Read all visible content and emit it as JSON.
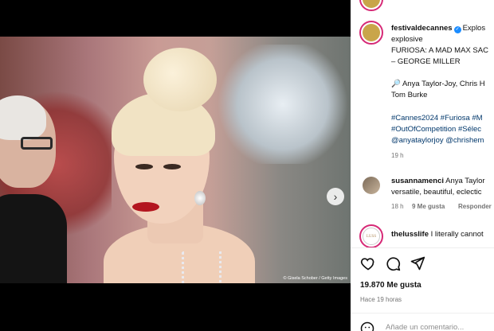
{
  "photo": {
    "credit": "© Gisela Schober / Getty Images",
    "next_icon": "chevron-right-icon",
    "carousel_dots": 7,
    "active_dot": 0
  },
  "post": {
    "username": "festivaldecannes",
    "caption_lines": [
      "Explos",
      "explosive",
      "FURIOSA: A MAD MAX SAC",
      "– GEORGE MILLER"
    ],
    "cast_line": "🔎 Anya Taylor-Joy, Chris H",
    "cast_line2": "Tom Burke",
    "hashtags": [
      "#Cannes2024 #Furiosa #M",
      "#OutOfCompetition #Sélec",
      "@anyataylorjoy @chrishem"
    ],
    "age": "19 h"
  },
  "comments": [
    {
      "username": "susannamenci",
      "text": "Anya Taylor",
      "text2": "versatile, beautiful, eclectic",
      "age": "18 h",
      "likes": "9 Me gusta",
      "reply": "Responder"
    },
    {
      "username": "theluss life",
      "display_username": "thelusslife",
      "text": "I literally cannot",
      "avatar_text": "LUSS"
    }
  ],
  "actions": {
    "like_icon": "heart-icon",
    "comment_icon": "comment-icon",
    "share_icon": "send-icon"
  },
  "likes_label": "19.870 Me gusta",
  "time_label": "Hace 19 horas",
  "add_comment_placeholder": "Añade un comentario..."
}
